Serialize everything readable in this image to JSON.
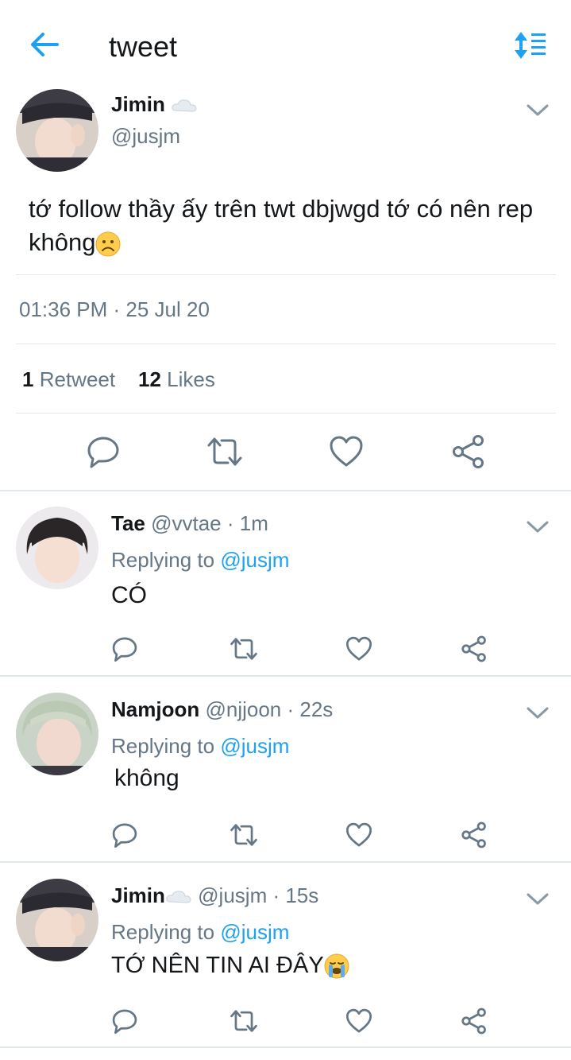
{
  "header": {
    "title": "tweet"
  },
  "main_tweet": {
    "name": "Jimin",
    "handle": "@jusjm",
    "text": "tớ follow thầy ấy trên twt dbjwgd tớ có nên rep không",
    "time": "01:36 PM",
    "date": "25 Jul 20",
    "retweet_count": "1",
    "retweet_label": "Retweet",
    "like_count": "12",
    "like_label": "Likes"
  },
  "replies": [
    {
      "name": "Tae",
      "handle": "@vvtae",
      "time": "1m",
      "replying_label": "Replying to",
      "replying_to": "@jusjm",
      "text": "CÓ"
    },
    {
      "name": "Namjoon",
      "handle": "@njjoon",
      "time": "22s",
      "replying_label": "Replying to",
      "replying_to": "@jusjm",
      "text": "không"
    },
    {
      "name": "Jimin",
      "handle": "@jusjm",
      "time": "15s",
      "replying_label": "Replying to",
      "replying_to": "@jusjm",
      "text": "TỚ NÊN TIN AI ĐÂY"
    }
  ],
  "colors": {
    "accent": "#1da1f2",
    "secondary_text": "#657786",
    "icon": "#657786",
    "divider": "#e1e8ed"
  },
  "icons": [
    "back-arrow-icon",
    "sort-icon",
    "cloud-icon",
    "chevron-down-icon",
    "reply-icon",
    "retweet-icon",
    "like-icon",
    "share-icon",
    "frowning-face-emoji",
    "crying-face-emoji"
  ]
}
